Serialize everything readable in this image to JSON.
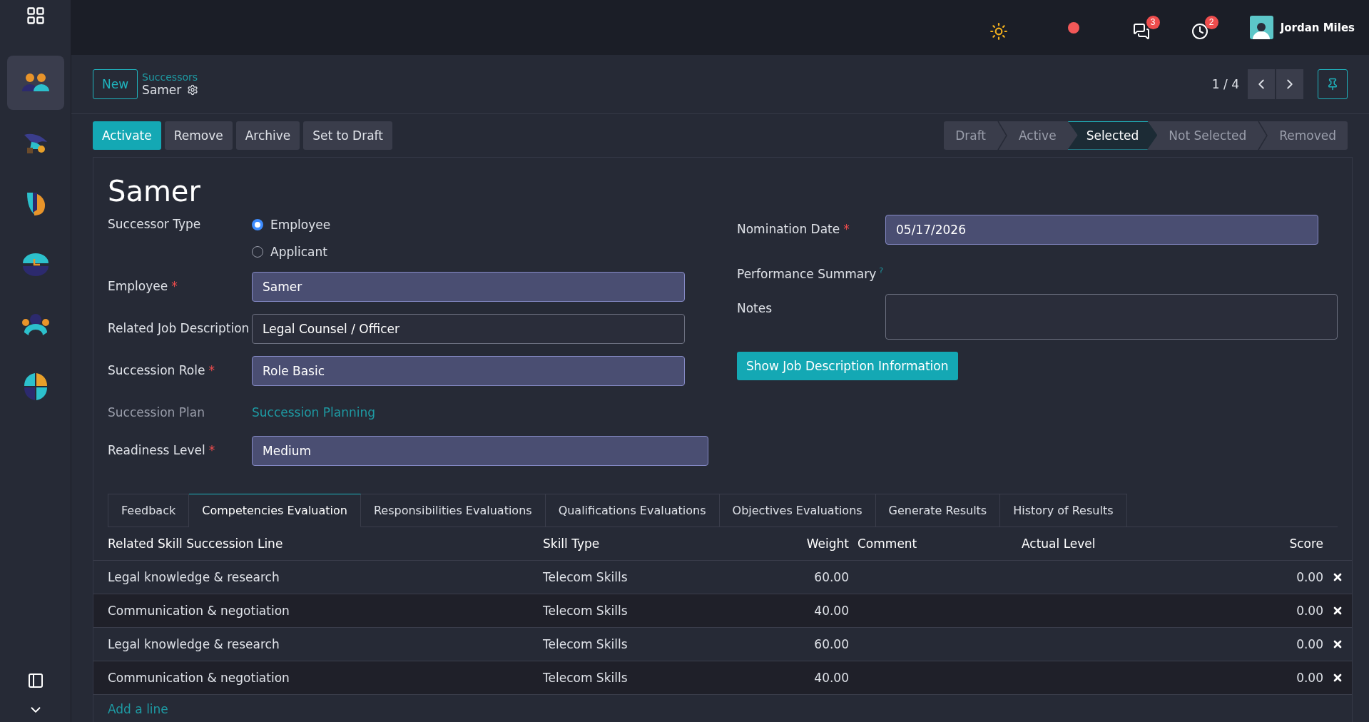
{
  "topbar": {
    "notifications": [
      {
        "kind": "messages",
        "count": "3"
      },
      {
        "kind": "activities",
        "count": "2"
      }
    ],
    "user": {
      "name": "Jordan Miles"
    }
  },
  "sidebar": {
    "apps": [
      {
        "kind": "people",
        "selected": true
      },
      {
        "kind": "bird",
        "selected": false
      },
      {
        "kind": "letter",
        "selected": false
      },
      {
        "kind": "clock",
        "selected": false
      },
      {
        "kind": "team",
        "selected": false
      },
      {
        "kind": "quarters",
        "selected": false
      }
    ]
  },
  "control_panel": {
    "new_button": "New",
    "breadcrumb": "Successors",
    "record": "Samer",
    "pager": "1 / 4"
  },
  "actions": [
    {
      "label": "Activate",
      "primary": true
    },
    {
      "label": "Remove",
      "primary": false
    },
    {
      "label": "Archive",
      "primary": false
    },
    {
      "label": "Set to Draft",
      "primary": false
    }
  ],
  "statusbar": [
    {
      "label": "Draft",
      "selected": false
    },
    {
      "label": "Active",
      "selected": false
    },
    {
      "label": "Selected",
      "selected": true
    },
    {
      "label": "Not Selected",
      "selected": false
    },
    {
      "label": "Removed",
      "selected": false
    }
  ],
  "form": {
    "title": "Samer",
    "successor_type": {
      "label": "Successor Type",
      "options": [
        {
          "label": "Employee",
          "selected": true
        },
        {
          "label": "Applicant",
          "selected": false
        }
      ]
    },
    "left_fields": [
      {
        "label": "Employee",
        "required_mark": "*",
        "kind": "input",
        "value": "Samer"
      },
      {
        "label": "Related Job Description",
        "kind": "input",
        "value": "Legal Counsel / Officer"
      },
      {
        "label": "Succession Role",
        "required_mark": "*",
        "kind": "input",
        "value": "Role Basic"
      },
      {
        "label": "Succession Plan",
        "kind": "link",
        "value": "Succession Planning"
      },
      {
        "label": "Readiness Level",
        "required_mark": "*",
        "kind": "select",
        "value": "Medium"
      }
    ],
    "right_fields": [
      {
        "label": "Nomination Date",
        "required_mark": "*",
        "kind": "input",
        "value": "05/17/2026"
      },
      {
        "label": "Performance Summary",
        "help_mark": "?",
        "kind": "empty"
      },
      {
        "label": "Notes",
        "kind": "textarea"
      }
    ],
    "info_button": "Show Job Description Information"
  },
  "tabs": [
    {
      "label": "Feedback",
      "selected": false
    },
    {
      "label": "Competencies Evaluation",
      "selected": true
    },
    {
      "label": "Responsibilities Evaluations",
      "selected": false
    },
    {
      "label": "Qualifications Evaluations",
      "selected": false
    },
    {
      "label": "Objectives Evaluations",
      "selected": false
    },
    {
      "label": "Generate Results",
      "selected": false
    },
    {
      "label": "History of Results",
      "selected": false
    }
  ],
  "table": {
    "columns": [
      "Related Skill Succession Line",
      "Skill Type",
      "Weight",
      "Comment",
      "Actual Level",
      "Score"
    ],
    "rows": [
      [
        "Legal knowledge & research",
        "Telecom Skills",
        "60.00",
        "",
        "",
        "0.00"
      ],
      [
        "Communication & negotiation",
        "Telecom Skills",
        "40.00",
        "",
        "",
        "0.00"
      ],
      [
        "Legal knowledge & research",
        "Telecom Skills",
        "60.00",
        "",
        "",
        "0.00"
      ],
      [
        "Communication & negotiation",
        "Telecom Skills",
        "40.00",
        "",
        "",
        "0.00"
      ]
    ],
    "add_line": "Add a line"
  }
}
